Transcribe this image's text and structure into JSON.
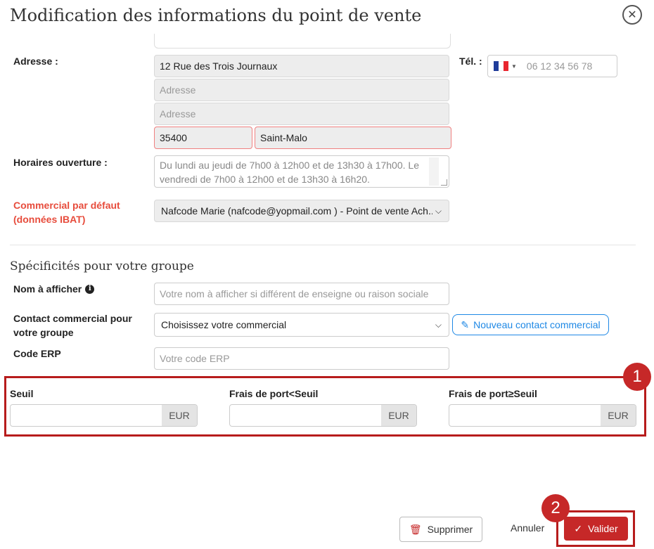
{
  "modal": {
    "title": "Modification des informations du point de vente",
    "close_icon": "close-icon"
  },
  "address": {
    "label": "Adresse :",
    "line1": "12 Rue des Trois Journaux",
    "line2_placeholder": "Adresse",
    "line3_placeholder": "Adresse",
    "postal_code": "35400",
    "city": "Saint-Malo"
  },
  "phone": {
    "label": "Tél. :",
    "country_flag": "france-flag-icon",
    "placeholder": "06 12 34 56 78"
  },
  "hours": {
    "label": "Horaires ouverture :",
    "placeholder": "Du lundi au jeudi de 7h00 à 12h00 et de 13h30 à 17h00. Le vendredi de 7h00 à 12h00 et de 13h30 à 16h20."
  },
  "default_sales": {
    "label_line1": "Commercial par défaut",
    "label_line2": "(données IBAT)",
    "value": "Nafcode Marie (nafcode@yopmail.com ) - Point de vente Ach..."
  },
  "group": {
    "section_title": "Spécificités pour votre groupe",
    "display_name_label": "Nom à afficher",
    "display_name_placeholder": "Votre nom à afficher si différent de enseigne ou raison sociale",
    "contact_label_line1": "Contact commercial pour",
    "contact_label_line2": "votre groupe",
    "contact_value": "Choisissez votre commercial",
    "new_contact_button": "Nouveau contact commercial",
    "erp_label": "Code ERP",
    "erp_placeholder": "Votre code ERP"
  },
  "thresholds": {
    "seuil_label": "Seuil",
    "shipping_below_label": "Frais de port<Seuil",
    "shipping_above_label": "Frais de port≥Seuil",
    "currency": "EUR"
  },
  "annotations": {
    "badge1": "1",
    "badge2": "2",
    "highlight_color": "#b71c1c"
  },
  "footer": {
    "delete_button": "Supprimer",
    "cancel_button": "Annuler",
    "validate_button": "Valider"
  },
  "colors": {
    "primary_red": "#c62828",
    "link_blue": "#1e88e5",
    "error_label": "#e74c3c"
  }
}
